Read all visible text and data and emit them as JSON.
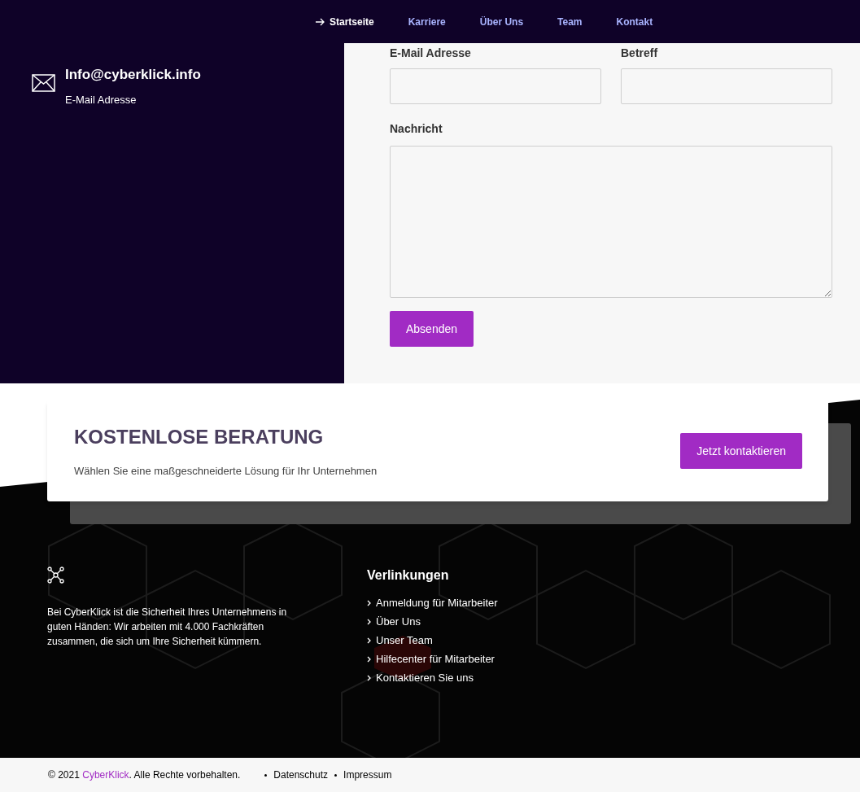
{
  "nav": {
    "items": [
      {
        "label": "Startseite",
        "selected": true
      },
      {
        "label": "Karriere",
        "selected": false
      },
      {
        "label": "Über Uns",
        "selected": false
      },
      {
        "label": "Team",
        "selected": false
      },
      {
        "label": "Kontakt",
        "selected": false
      }
    ]
  },
  "contact_info": {
    "email": "Info@cyberklick.info",
    "caption": "E-Mail Adresse"
  },
  "form": {
    "fields": [
      {
        "label": "E-Mail Adresse",
        "kind": "input"
      },
      {
        "label": "Betreff",
        "kind": "input"
      },
      {
        "label": "Nachricht",
        "kind": "textarea"
      }
    ],
    "submit": "Absenden"
  },
  "cta": {
    "title": "KOSTENLOSE BERATUNG",
    "text": "Wählen Sie eine maßgeschneiderte Lösung für Ihr Unternehmen",
    "button": "Jetzt kontaktieren"
  },
  "footer": {
    "about": "Bei CyberKlick ist die Sicherheit Ihres Unternehmens in guten Händen: Wir arbeiten mit 4.000 Fachkräften zusammen, die sich um Ihre Sicherheit kümmern.",
    "links_title": "Verlinkungen",
    "links": [
      "Anmeldung für Mitarbeiter",
      "Über Uns",
      "Unser Team",
      "Hilfecenter für Mitarbeiter",
      "Kontaktieren Sie uns"
    ]
  },
  "bottom_bar": {
    "copyright_prefix": "© 2021",
    "brand": "CyberKlick",
    "copyright_suffix": ". Alle Rechte vorbehalten.",
    "links": [
      "Datenschutz",
      "Impressum"
    ]
  }
}
